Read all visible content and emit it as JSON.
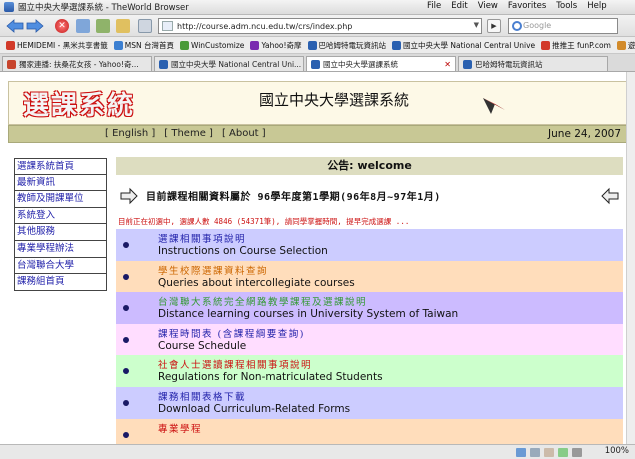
{
  "browser": {
    "window_title": "國立中央大學選課系統 - TheWorld Browser",
    "menu": [
      "File",
      "Edit",
      "View",
      "Favorites",
      "Tools",
      "Help"
    ],
    "url": "http://course.adm.ncu.edu.tw/crs/index.php",
    "search_placeholder": "Google",
    "bookmarks": [
      {
        "label": "HEMIDEMI - 黑米共享書籤",
        "color": "#d23a2a"
      },
      {
        "label": "MSN 台灣首頁",
        "color": "#3b7fd1"
      },
      {
        "label": "WinCustomize",
        "color": "#4a9a3a"
      },
      {
        "label": "Yahoo!奇摩",
        "color": "#7a2ab0"
      },
      {
        "label": "巴哈姆特電玩資訊站",
        "color": "#2a60b0"
      },
      {
        "label": "國立中央大學 National Central Unive",
        "color": "#2a60b0"
      },
      {
        "label": "推推王 funP.com",
        "color": "#d23a2a"
      },
      {
        "label": "遊戲",
        "color": "#d28a2a"
      }
    ],
    "tabs": [
      {
        "label": "獨家連播: 扶桑花女孩 - Yahoo!奇...",
        "active": false
      },
      {
        "label": "國立中央大學 National Central Uni...",
        "active": false
      },
      {
        "label": "國立中央大學選課系統",
        "active": true
      },
      {
        "label": "巴哈姆特電玩資訊站",
        "active": false
      }
    ],
    "tab_close": "✕",
    "zoom": "100%"
  },
  "header": {
    "logo_text": "選課系統",
    "site_title": "國立中央大學選課系統"
  },
  "menu_strip": {
    "links": [
      "[ English ]",
      "[ Theme ]",
      "[ About ]"
    ],
    "date": "June 24, 2007"
  },
  "sidebar": {
    "items": [
      "選課系統首頁",
      "最新資訊",
      "教師及開課單位",
      "系統登入",
      "其他服務",
      "專業學程辦法",
      "台灣聯合大學",
      "課務組首頁"
    ]
  },
  "notice": {
    "title": "公告: welcome",
    "semester": "目前課程相關資料屬於 96學年度第1學期(96年8月~97年1月)",
    "alert": "目前正在初選中, 選課人數 4846 (54371筆), 請同學掌握時間, 提早完成選課 ..."
  },
  "links": [
    {
      "zh": "選課相關事項說明",
      "en": "Instructions on Course Selection",
      "bg": "#ccccff",
      "zh_color": "#2222aa"
    },
    {
      "zh": "學生校際選課資料查詢",
      "en": "Queries about intercollegiate courses",
      "bg": "#ffddbb",
      "zh_color": "#cc6600"
    },
    {
      "zh": "台灣聯大系統完全網路教學課程及選課說明",
      "en": "Distance learning courses in University System of Taiwan",
      "bg": "#ccbbff",
      "zh_color": "#339933"
    },
    {
      "zh": "課程時間表 (含課程綱要查詢)",
      "en": "Course Schedule",
      "bg": "#ffddff",
      "zh_color": "#2222aa"
    },
    {
      "zh": "社會人士選讀課程相關事項說明",
      "en": "Regulations for Non-matriculated Students",
      "bg": "#ccffcc",
      "zh_color": "#cc1111"
    },
    {
      "zh": "課務相關表格下載",
      "en": "Download Curriculum-Related Forms",
      "bg": "#ccccff",
      "zh_color": "#2222aa"
    },
    {
      "zh": "專業學程",
      "en": "",
      "bg": "#ffddbb",
      "zh_color": "#cc1111"
    }
  ]
}
